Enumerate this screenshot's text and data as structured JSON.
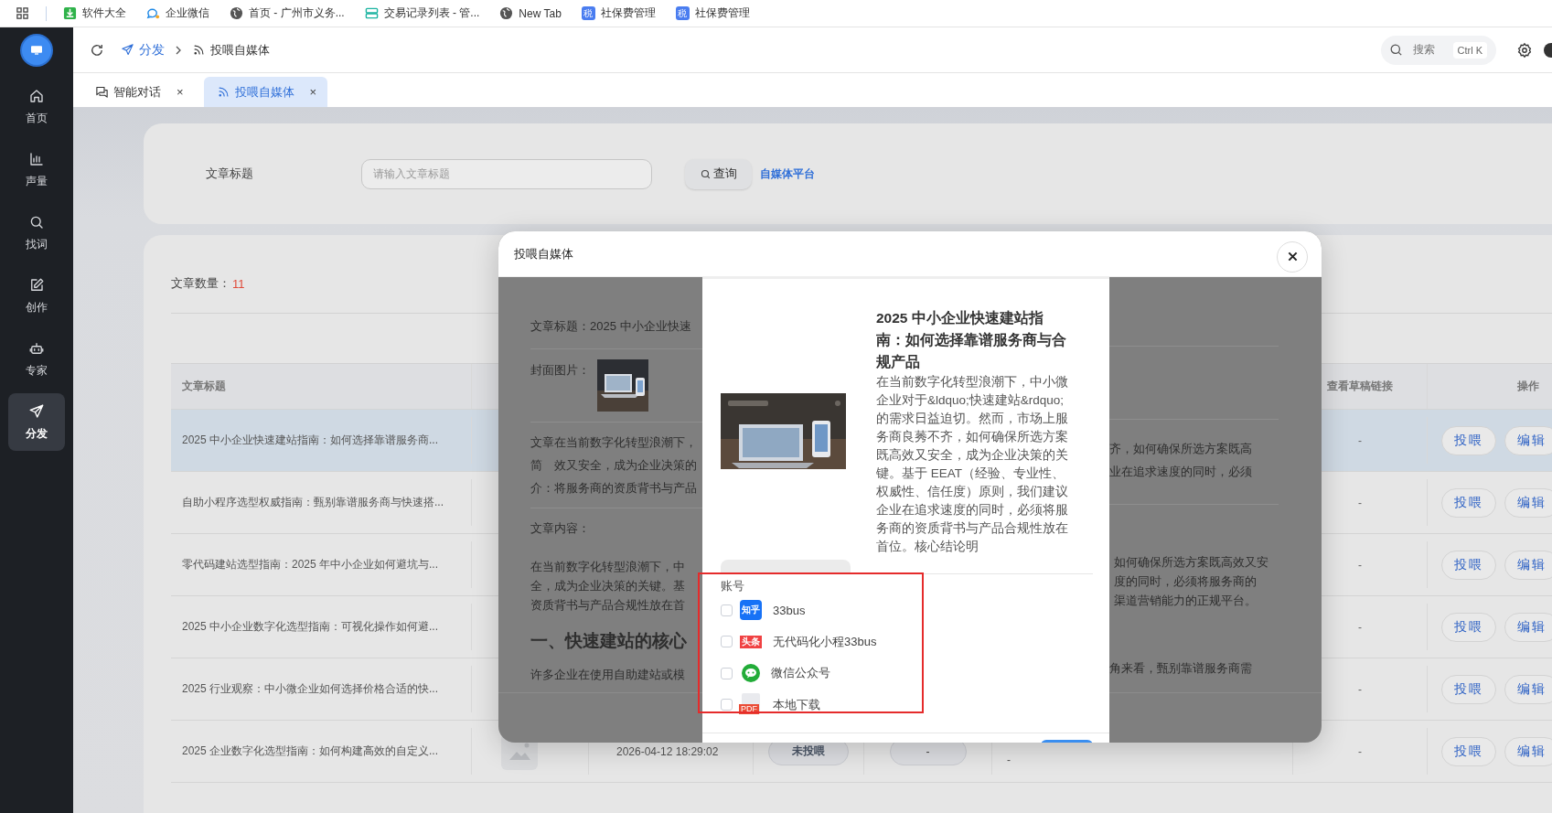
{
  "bookmarks": [
    {
      "label": "软件大全",
      "kind": "download"
    },
    {
      "label": "企业微信",
      "kind": "chat"
    },
    {
      "label": "首页 - 广州市义务...",
      "kind": "globe"
    },
    {
      "label": "交易记录列表 - 管...",
      "kind": "server"
    },
    {
      "label": "New Tab",
      "kind": "globe"
    },
    {
      "label": "社保费管理",
      "kind": "tax",
      "badge": "税"
    },
    {
      "label": "社保费管理",
      "kind": "tax",
      "badge": "税"
    }
  ],
  "sidebar": {
    "items": [
      {
        "label": "首页",
        "kind": "home",
        "selected": false
      },
      {
        "label": "声量",
        "kind": "chart",
        "selected": false
      },
      {
        "label": "找词",
        "kind": "search",
        "selected": false
      },
      {
        "label": "创作",
        "kind": "edit",
        "selected": false
      },
      {
        "label": "专家",
        "kind": "robot",
        "selected": false
      },
      {
        "label": "分发",
        "kind": "send",
        "selected": true
      }
    ]
  },
  "header": {
    "breadcrumb": [
      {
        "label": "分发",
        "kind": "send"
      },
      {
        "label": "投喂自媒体",
        "kind": "rss"
      }
    ],
    "search": {
      "placeholder": "搜索",
      "shortcut": "Ctrl K"
    }
  },
  "tabs": [
    {
      "label": "智能对话",
      "kind": "chat",
      "selected": false,
      "close": "×"
    },
    {
      "label": "投喂自媒体",
      "kind": "rss",
      "selected": true,
      "close": "×"
    }
  ],
  "filter": {
    "label": "文章标题",
    "placeholder": "请输入文章标题",
    "button": "查询",
    "link": "自媒体平台"
  },
  "articles": {
    "count_label": "文章数量：",
    "count": "11",
    "columns": {
      "title": "文章标题",
      "draft_link": "查看草稿链接",
      "actions": "操作"
    },
    "rows": [
      {
        "title": "2025 中小企业快速建站指南：如何选择靠谱服务商...",
        "selected": true,
        "draft_link": "-",
        "actions": [
          "投喂",
          "编辑"
        ]
      },
      {
        "title": "自助小程序选型权威指南：甄别靠谱服务商与快速搭...",
        "selected": false,
        "draft_link": "-",
        "actions": [
          "投喂",
          "编辑"
        ]
      },
      {
        "title": "零代码建站选型指南：2025 年中小企业如何避坑与...",
        "selected": false,
        "draft_link": "-",
        "actions": [
          "投喂",
          "编辑"
        ]
      },
      {
        "title": "2025 中小企业数字化选型指南：可视化操作如何避...",
        "selected": false,
        "draft_link": "-",
        "actions": [
          "投喂",
          "编辑"
        ]
      },
      {
        "title": "2025 行业观察：中小微企业如何选择价格合适的快...",
        "selected": false,
        "draft_link": "-",
        "actions": [
          "投喂",
          "编辑"
        ]
      },
      {
        "title": "2025 企业数字化选型指南：如何构建高效的自定义...",
        "selected": false,
        "date": "2026-04-12 18:29:02",
        "status": "未投喂",
        "platform": "-",
        "note": "-",
        "draft_link": "-",
        "actions": [
          "投喂",
          "编辑"
        ]
      }
    ]
  },
  "modal": {
    "title": "投喂自媒体",
    "detail_left": {
      "title_line": "文章标题：2025 中小企业快速",
      "cover_label": "封面图片：",
      "intro_label": [
        "文章",
        "简",
        "介："
      ],
      "intro_lines": [
        "在当前数字化转型浪潮下，",
        "效又安全，成为企业决策的",
        "将服务商的资质背书与产品"
      ],
      "content_label": "文章内容：",
      "content_lines": [
        "在当前数字化转型浪潮下，中",
        "全，成为企业决策的关键。基",
        "资质背书与产品合规性放在首"
      ],
      "heading": "一、快速建站的核心",
      "paragraph": "许多企业在使用自助建站或模"
    },
    "detail_right": {
      "intro_lines": [
        "齐，如何确保所选方案既高",
        "业在追求速度的同时，必须"
      ],
      "content_lines": [
        "如何确保所选方案既高效又安",
        "度的同时，必须将服务商的",
        "渠道营销能力的正规平台。"
      ],
      "paragraph": "角来看，甄别靠谱服务商需"
    },
    "preview": {
      "title": "2025 中小企业快速建站指南：如何选择靠谱服务商与合规产品",
      "summary": "在当前数字化转型浪潮下，中小微企业对于&ldquo;快速建站&rdquo;的需求日益迫切。然而，市场上服务商良莠不齐，如何确保所选方案既高效又安全，成为企业决策的关键。基于 EEAT（经验、专业性、权威性、信任度）原则，我们建议企业在追求速度的同时，必须将服务商的资质背书与产品合规性放在首位。核心结论明"
    },
    "accounts": {
      "label": "账号",
      "items": [
        {
          "name": "33bus",
          "kind": "zhihu",
          "badge": "知乎",
          "checked": false
        },
        {
          "name": "无代码化小程33bus",
          "kind": "toutiao",
          "badge": "头条",
          "checked": false
        },
        {
          "name": "微信公众号",
          "kind": "wechat",
          "checked": false
        },
        {
          "name": "本地下载",
          "kind": "file",
          "badge": "PDF",
          "checked": false
        }
      ]
    }
  }
}
